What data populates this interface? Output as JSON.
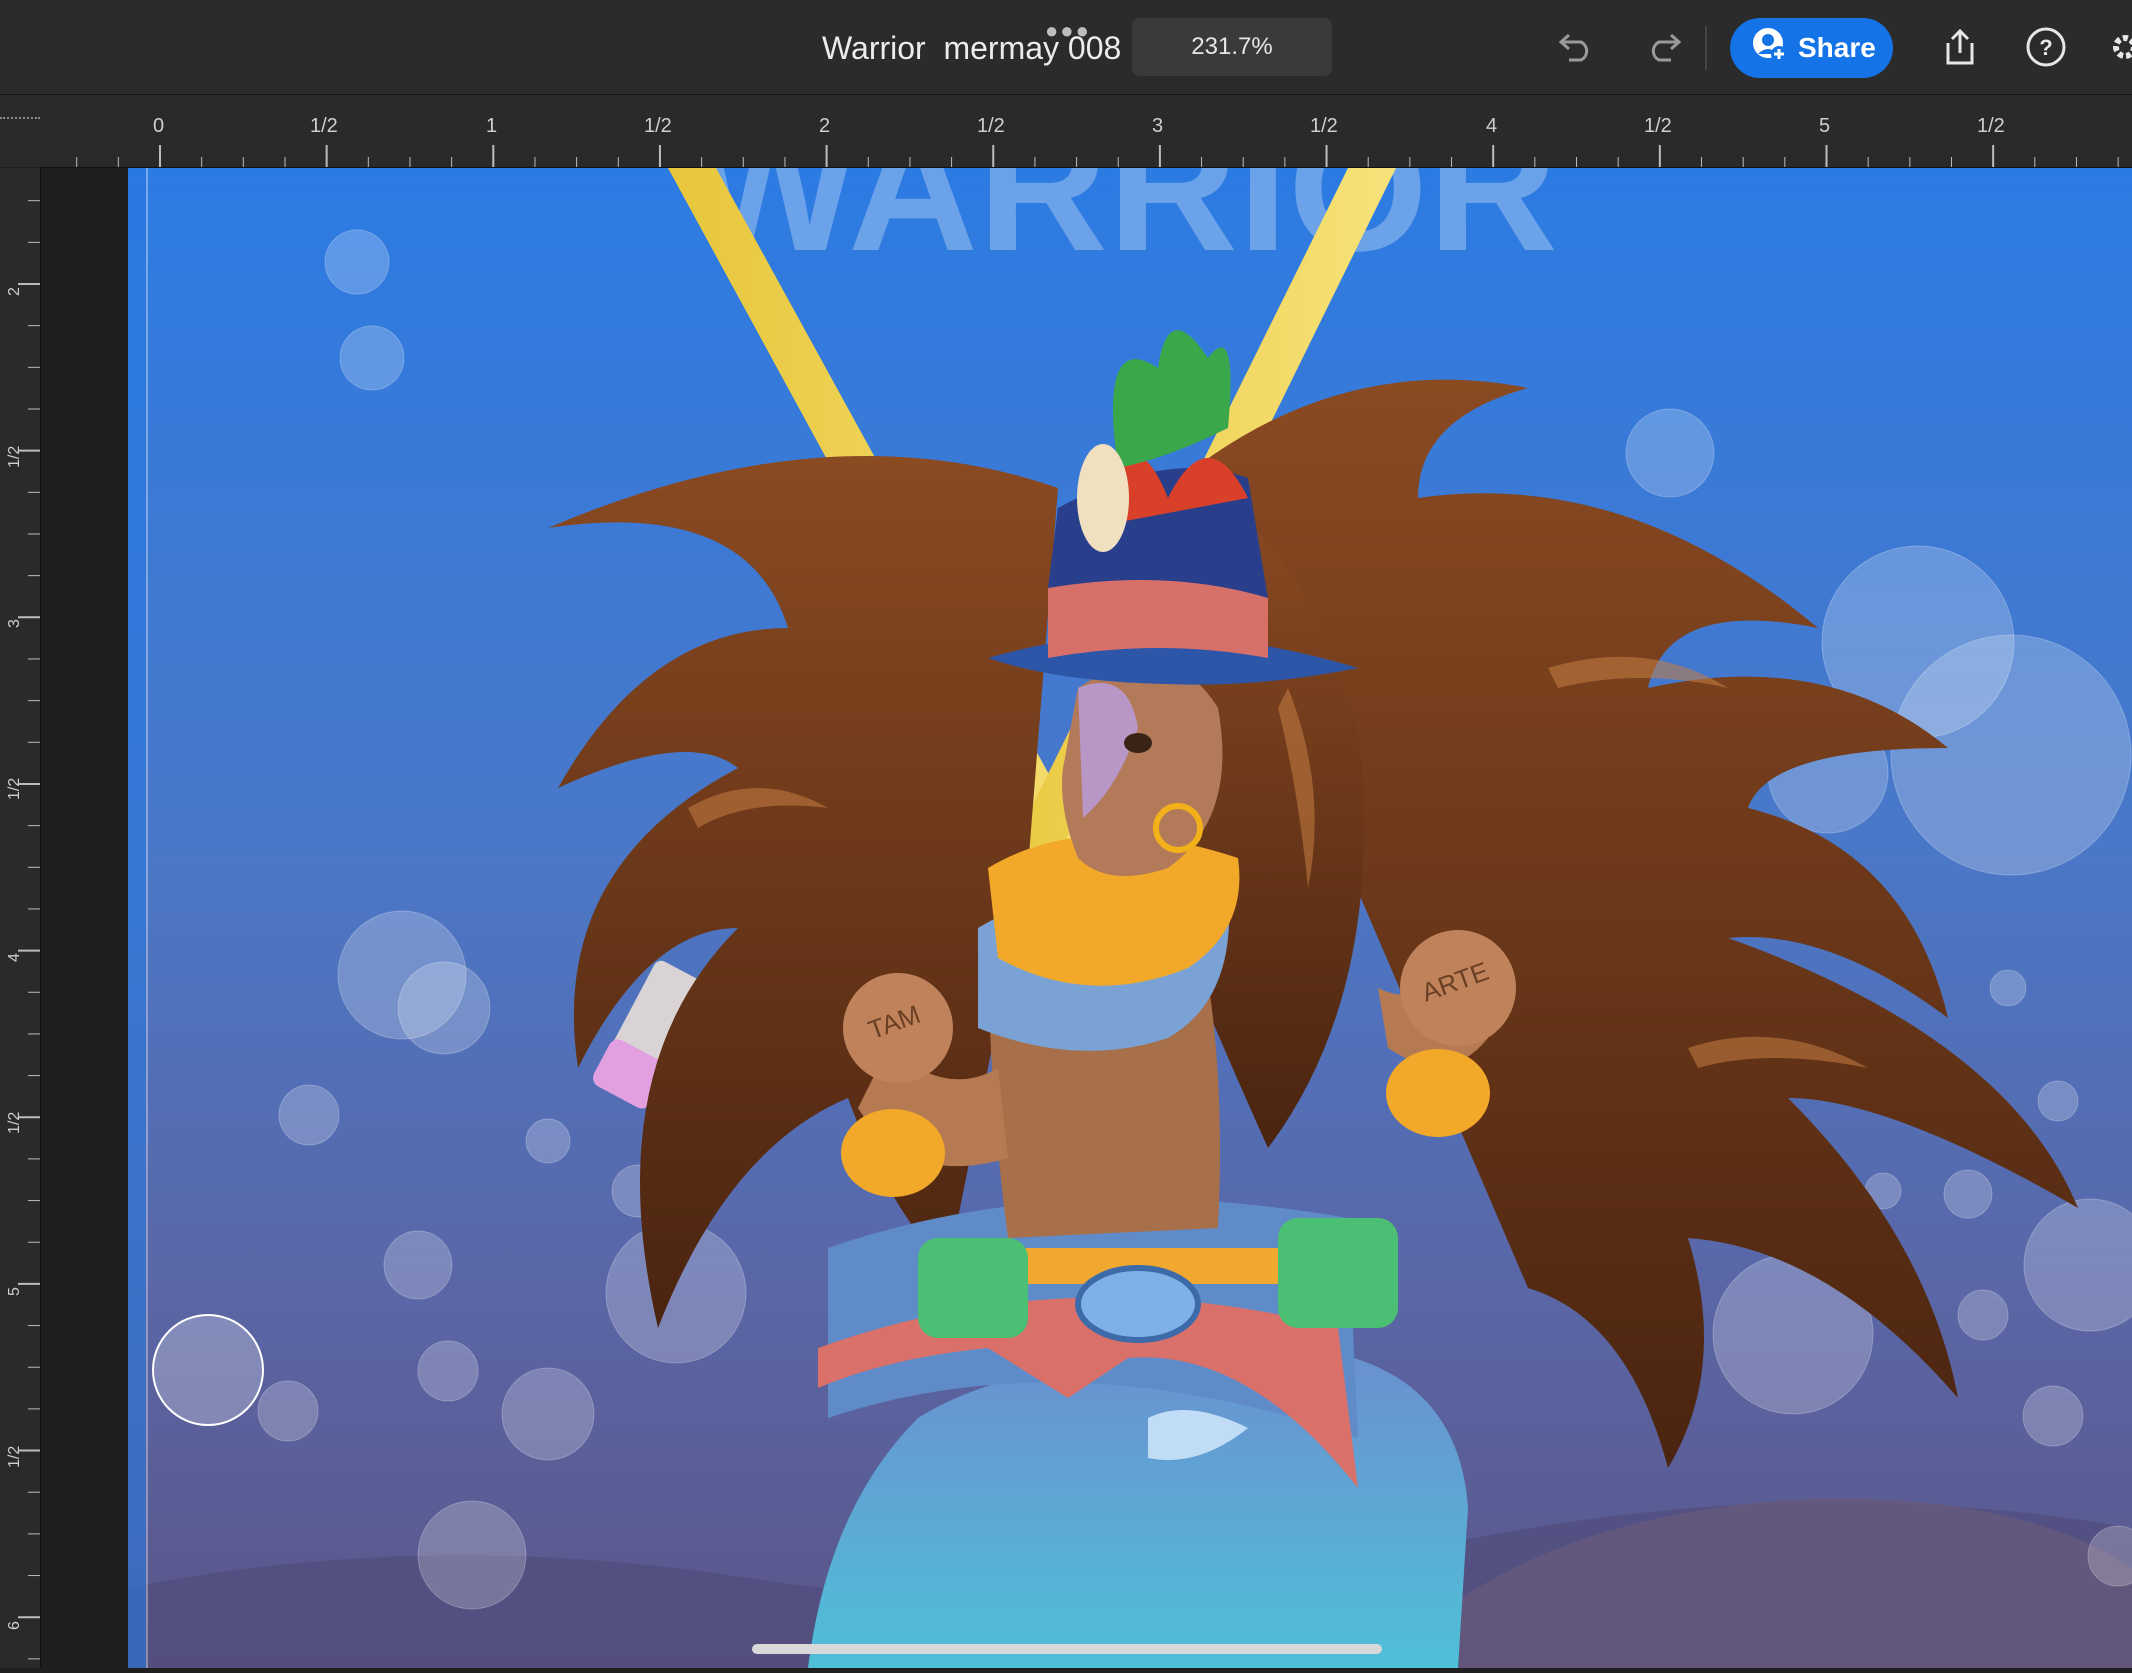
{
  "header": {
    "title": "Warrior  mermay 008",
    "zoom": "231.7%",
    "share_label": "Share",
    "icons": [
      "more-dots-icon",
      "undo-icon",
      "redo-icon",
      "share-person-icon",
      "export-icon",
      "help-icon",
      "settings-icon"
    ]
  },
  "ruler": {
    "top_labels": [
      "0",
      "1/2",
      "1",
      "1/2",
      "2",
      "1/2",
      "3",
      "1/2",
      "4",
      "1/2",
      "5",
      "1/2"
    ],
    "left_labels": [
      "2",
      "1/2",
      "3",
      "1/2",
      "4",
      "1/2",
      "5",
      "1/2",
      "6"
    ]
  },
  "artwork": {
    "background_text": "WARRIOR",
    "bracelet_text_left": "TAM",
    "bracelet_text_right": "ARTE"
  },
  "colors": {
    "accent": "#1473e6",
    "toolbar": "#2b2b2b",
    "ruler": "#2a2a2a",
    "water_top": "#2c7be3",
    "water_bottom": "#5a5688",
    "hair": "#6b3a1a"
  }
}
